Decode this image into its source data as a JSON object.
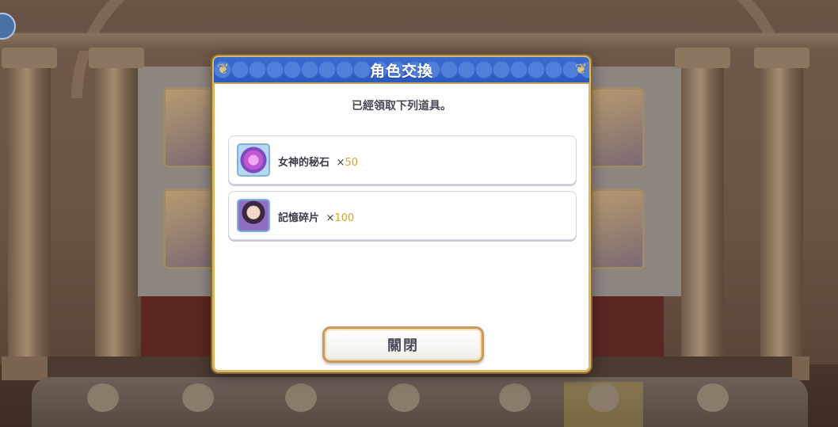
{
  "modal": {
    "title": "角色交換",
    "message": "已經領取下列道具。",
    "items": [
      {
        "name": "女神的秘石",
        "multiplier": "×",
        "quantity": "50",
        "icon": "goddess-stone-icon"
      },
      {
        "name": "記憶碎片",
        "multiplier": "×",
        "quantity": "100",
        "icon": "memory-piece-icon"
      }
    ],
    "close_label": "關閉"
  },
  "colors": {
    "header_blue": "#3a6ad0",
    "frame_gold": "#d8b868",
    "quantity_orange": "#e0a020"
  }
}
